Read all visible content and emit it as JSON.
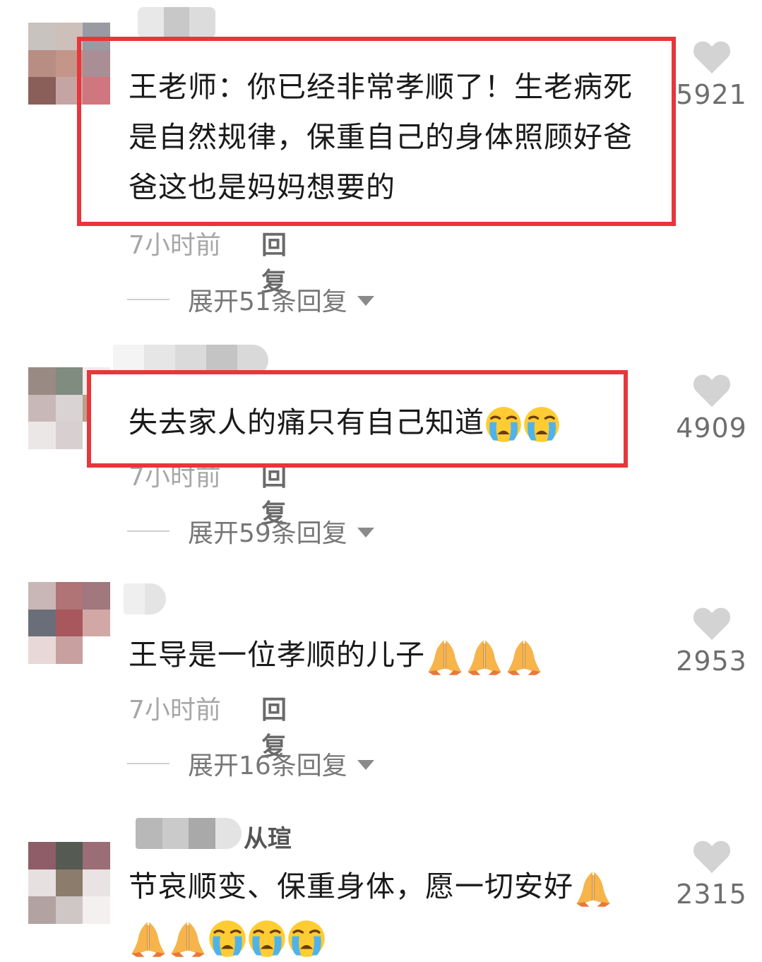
{
  "comments": [
    {
      "text": "王老师：你已经非常孝顺了！生老病死是自然规律，保重自己的身体照顾好爸爸这也是妈妈想要的",
      "time": "7小时前",
      "reply": "回复",
      "expand": "展开51条回复",
      "likes": "5921"
    },
    {
      "text": "失去家人的痛只有自己知道",
      "time": "7小时前",
      "reply": "回复",
      "expand": "展开59条回复",
      "likes": "4909"
    },
    {
      "text": "王导是一位孝顺的儿子",
      "time": "7小时前",
      "reply": "回复",
      "expand": "展开16条回复",
      "likes": "2953"
    },
    {
      "username_suffix": "从瑄",
      "text": "节哀顺变、保重身体，愿一切安好",
      "likes": "2315"
    }
  ],
  "colors": {
    "highlight_border": "#e8363a",
    "heart": "#d3d3d3",
    "text": "#1a1a1a",
    "muted": "#a7a7a7"
  },
  "icons": [
    "heart-icon",
    "crying-emoji",
    "praying-hands-emoji",
    "chevron-down-icon"
  ]
}
